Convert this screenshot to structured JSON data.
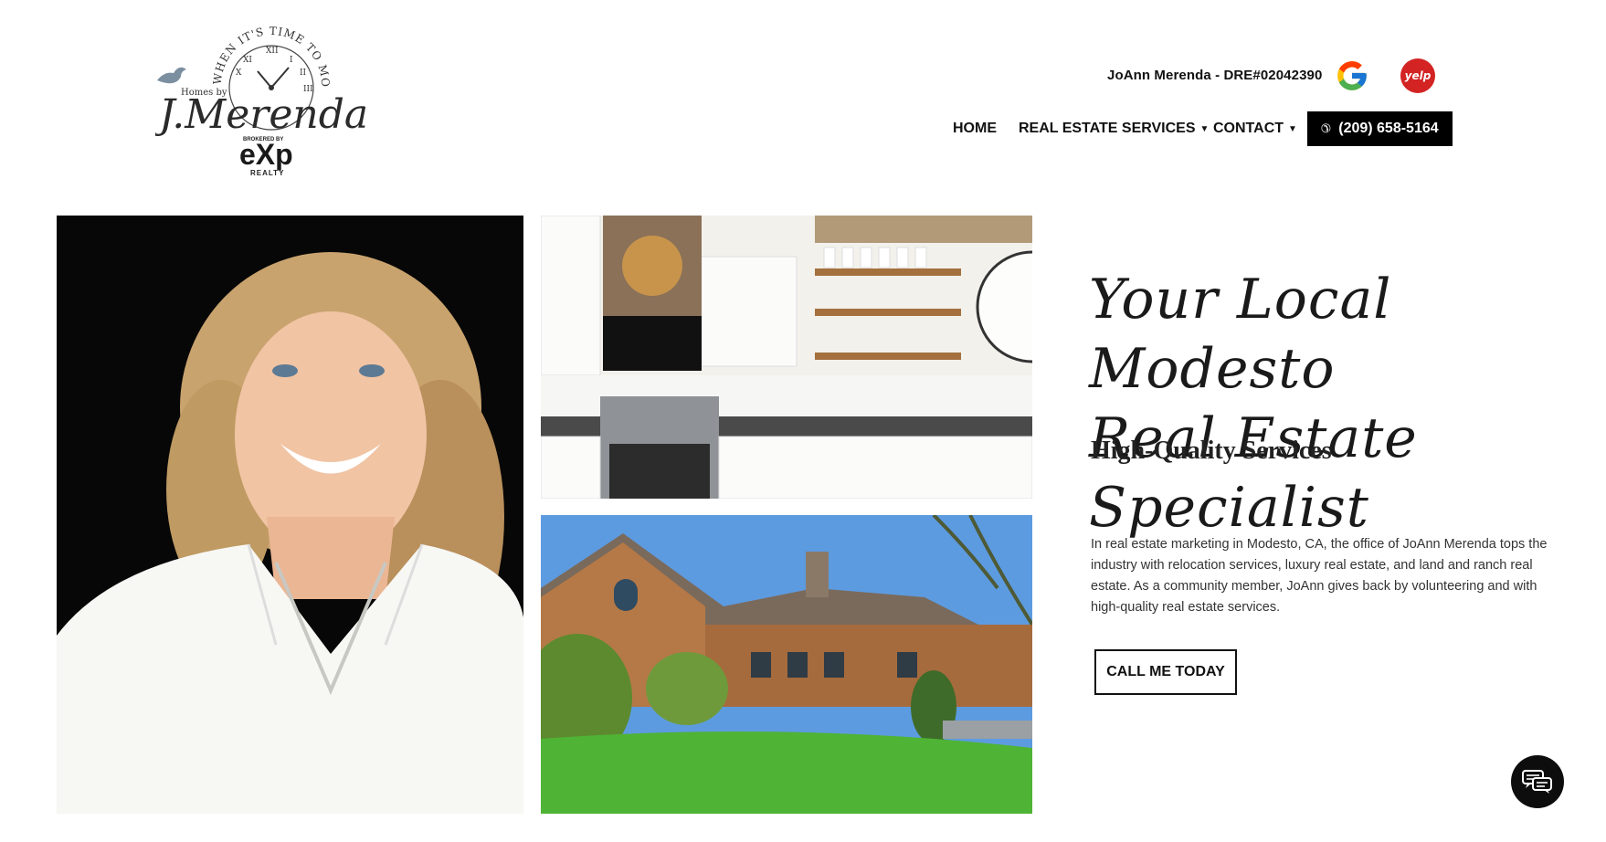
{
  "brand": {
    "logo_arc": "WHEN IT'S TIME TO MOVE",
    "logo_prefix": "Homes by",
    "logo_name": "J.Merenda",
    "logo_brokered": "BROKERED BY",
    "logo_exp": "eXp",
    "logo_realty": "REALTY"
  },
  "header": {
    "agent_line": "JoAnn Merenda - DRE#02042390",
    "google_icon": "google-icon",
    "yelp_label": "yelp",
    "yelp_color": "#d32323"
  },
  "nav": {
    "home": "HOME",
    "services": "REAL ESTATE SERVICES",
    "contact": "CONTACT",
    "phone": "(209) 658-5164"
  },
  "hero": {
    "headline_line1": "Your Local Modesto",
    "headline_line2": "Real Estate Specialist",
    "subhead": "High-Quality Services",
    "body": "In real estate marketing in Modesto, CA, the office of JoAnn Merenda tops the industry with relocation services, luxury real estate, and land and ranch real estate. As a community member, JoAnn gives back by volunteering and with high-quality real estate services.",
    "cta": "CALL ME TODAY"
  },
  "colors": {
    "accent": "#000000",
    "text": "#111111"
  }
}
